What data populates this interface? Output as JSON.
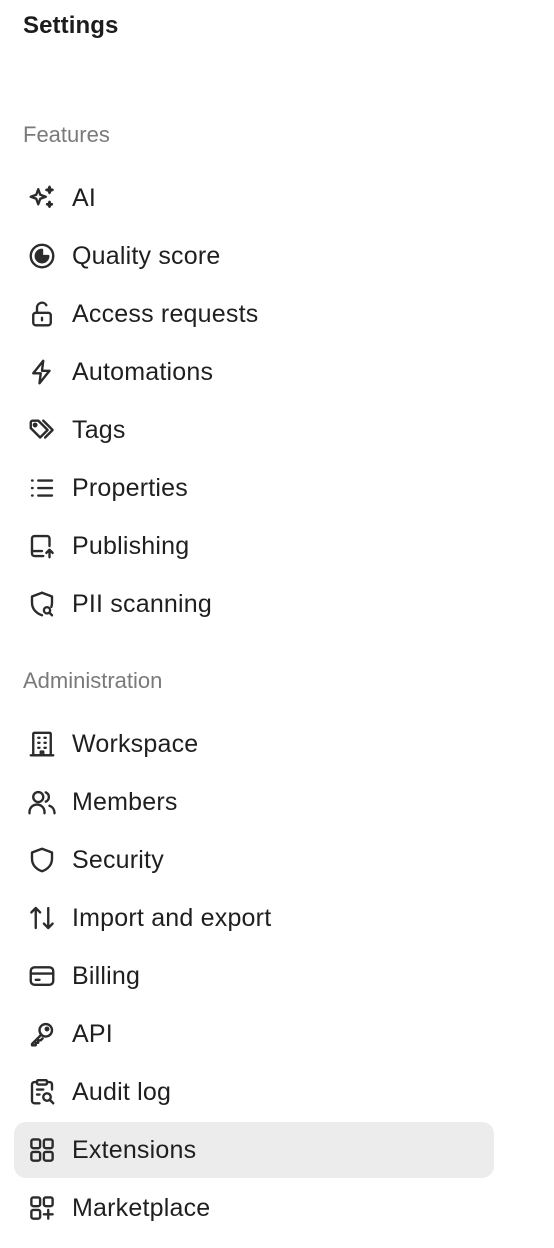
{
  "header": {
    "title": "Settings"
  },
  "sections": [
    {
      "label": "Features",
      "items": [
        {
          "label": "AI",
          "icon": "sparkles-icon"
        },
        {
          "label": "Quality score",
          "icon": "quality-gauge-icon"
        },
        {
          "label": "Access requests",
          "icon": "unlock-icon"
        },
        {
          "label": "Automations",
          "icon": "lightning-icon"
        },
        {
          "label": "Tags",
          "icon": "tags-icon"
        },
        {
          "label": "Properties",
          "icon": "list-icon"
        },
        {
          "label": "Publishing",
          "icon": "publish-upload-icon"
        },
        {
          "label": "PII scanning",
          "icon": "shield-search-icon"
        }
      ]
    },
    {
      "label": "Administration",
      "items": [
        {
          "label": "Workspace",
          "icon": "building-icon"
        },
        {
          "label": "Members",
          "icon": "users-icon"
        },
        {
          "label": "Security",
          "icon": "shield-icon"
        },
        {
          "label": "Import and export",
          "icon": "arrows-up-down-icon"
        },
        {
          "label": "Billing",
          "icon": "credit-card-icon"
        },
        {
          "label": "API",
          "icon": "key-icon"
        },
        {
          "label": "Audit log",
          "icon": "clipboard-search-icon"
        },
        {
          "label": "Extensions",
          "icon": "grid-icon",
          "active": true
        },
        {
          "label": "Marketplace",
          "icon": "grid-plus-icon"
        }
      ]
    }
  ],
  "colors": {
    "active_bg": "#ececec",
    "section_label": "#7a7a7a",
    "text": "#1f1f1f"
  }
}
